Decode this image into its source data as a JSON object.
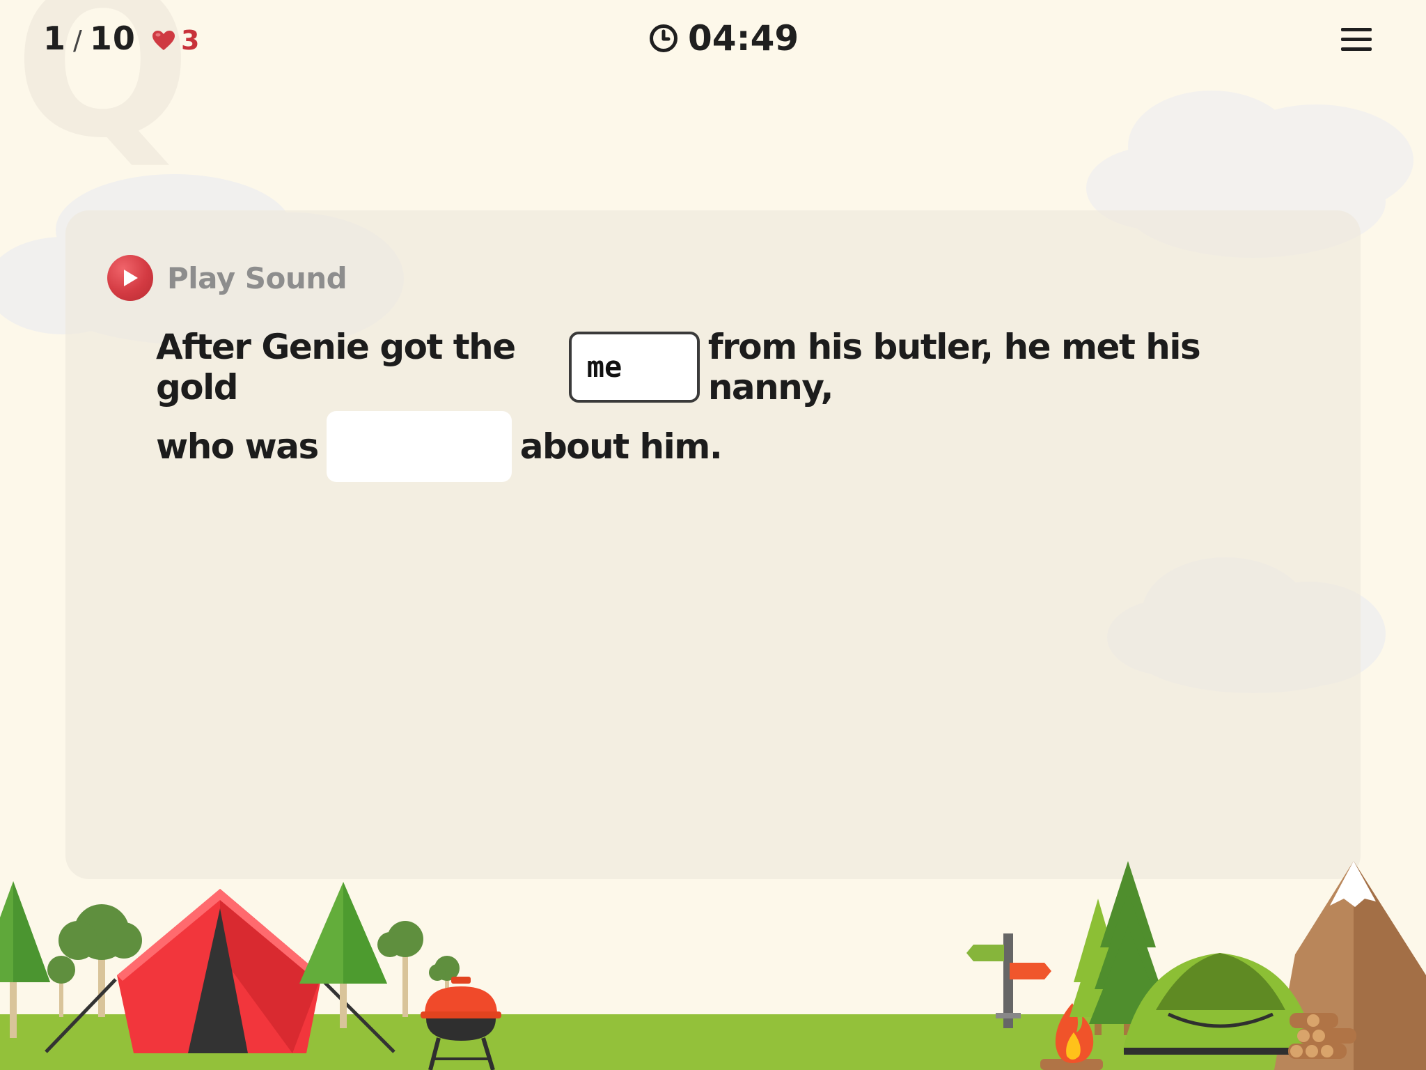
{
  "header": {
    "progress_current": "1",
    "progress_separator": "/",
    "progress_total": "10",
    "lives": "3",
    "timer": "04:49",
    "menu_icon": "hamburger-menu-icon",
    "timer_icon": "clock-icon",
    "lives_icon": "heart-icon"
  },
  "question": {
    "play_sound_label": "Play Sound",
    "play_icon": "play-circle-icon",
    "line1_before": "After Genie got the gold",
    "blank1_value": "me",
    "line1_after": "from his butler, he met his nanny,",
    "line2_before": "who was",
    "blank2_value": "",
    "line2_after": "about him."
  },
  "colors": {
    "background": "#fdf8ea",
    "accent_red": "#d33a42",
    "grass": "#93c13a"
  }
}
